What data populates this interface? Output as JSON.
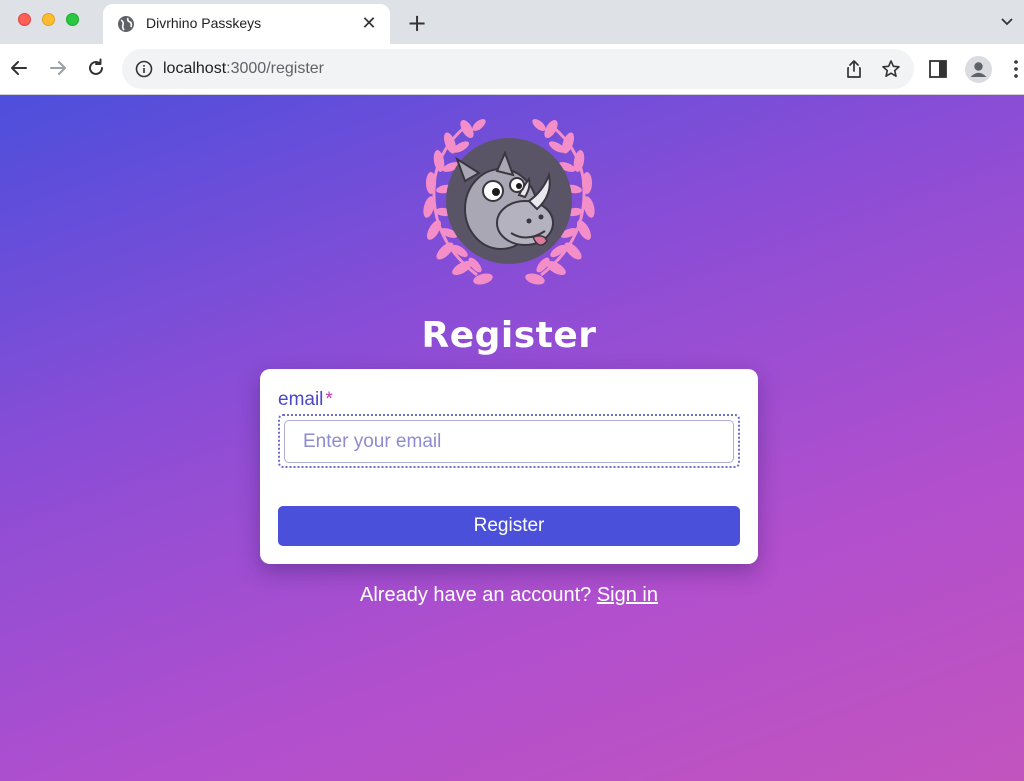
{
  "browser": {
    "tab": {
      "title": "Divrhino Passkeys",
      "close_glyph": "✕",
      "icon": "globe-icon"
    },
    "new_tab_glyph": "+",
    "address": {
      "host": "localhost",
      "path": ":3000/register"
    }
  },
  "page": {
    "heading": "Register",
    "form": {
      "email_label": "email",
      "required_mark": "*",
      "email_placeholder": "Enter your email",
      "submit_label": "Register"
    },
    "signin_prompt": "Already have an account?",
    "signin_link": "Sign in"
  },
  "colors": {
    "accent": "#4a50d9",
    "label": "#4a47c8",
    "required": "#c03ab2",
    "laurel": "#f48ec9",
    "gradient_start": "#4d4fdc",
    "gradient_end": "#c254be"
  }
}
